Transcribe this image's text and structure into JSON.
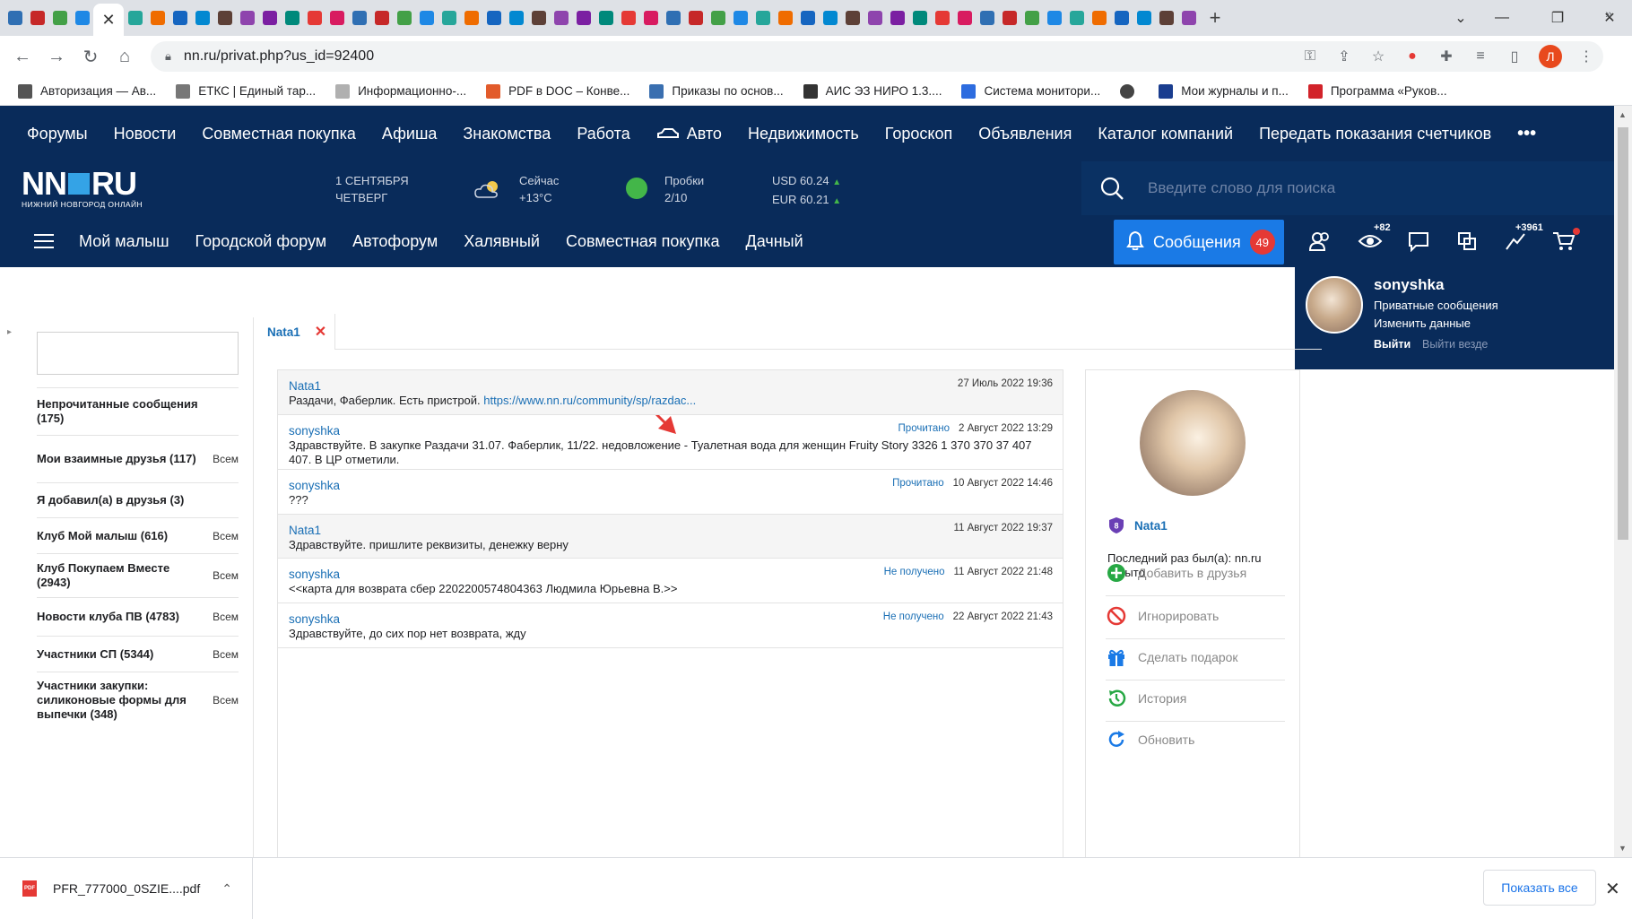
{
  "browser": {
    "tabs_count": 52,
    "active_tab_close": "✕",
    "new_tab": "+",
    "window_controls": {
      "minimize": "—",
      "restore": "❐",
      "close": "✕"
    },
    "url": "nn.ru/privat.php?us_id=92400",
    "profile_initial": "Л",
    "extension_badge": "4"
  },
  "bookmarks": [
    {
      "label": "Авторизация — Ав...",
      "color": "#555555"
    },
    {
      "label": "ЕТКС | Единый тар...",
      "color": "#777777"
    },
    {
      "label": "Информационно-...",
      "color": "#b0b0b0"
    },
    {
      "label": "PDF в DOC – Конве...",
      "color": "#e25b2b"
    },
    {
      "label": "Приказы по основ...",
      "color": "#3a6fb0"
    },
    {
      "label": "АИС ЭЗ НИРО 1.3....",
      "color": "#333333"
    },
    {
      "label": "Система монитори...",
      "color": "#2d6cdf"
    },
    {
      "label": "",
      "color": "#444444"
    },
    {
      "label": "Мои журналы и п...",
      "color": "#1a3d8f"
    },
    {
      "label": "Программа «Руков...",
      "color": "#d2232a"
    }
  ],
  "site": {
    "topnav": [
      "Форумы",
      "Новости",
      "Совместная покупка",
      "Афиша",
      "Знакомства",
      "Работа",
      "Авто",
      "Недвижимость",
      "Гороскоп",
      "Объявления",
      "Каталог компаний",
      "Передать показания счетчиков"
    ],
    "topnav_more": "•••",
    "logo_main_left": "NN",
    "logo_main_right": "RU",
    "logo_sub": "НИЖНИЙ НОВГОРОД ОНЛАЙН",
    "date_line1": "1 СЕНТЯБРЯ",
    "date_line2": "ЧЕТВЕРГ",
    "weather_label": "Сейчас",
    "weather_value": "+13°C",
    "traffic_label": "Пробки",
    "traffic_value": "2/10",
    "usd": "USD 60.24",
    "eur": "EUR 60.21",
    "search_placeholder": "Введите слово для поиска",
    "subnav": [
      "Мой малыш",
      "Городской форум",
      "Автофорум",
      "Халявный",
      "Совместная покупка",
      "Дачный"
    ],
    "messages_button": "Сообщения",
    "messages_count": "49",
    "views_count": "+82",
    "rating_count": "+3961"
  },
  "user_panel": {
    "username": "sonyshka",
    "private_messages": "Приватные сообщения",
    "edit_profile": "Изменить данные",
    "logout": "Выйти",
    "logout_all": "Выйти везде"
  },
  "sidebar": {
    "items": [
      {
        "label": "Непрочитанные сообщения (175)",
        "scope": ""
      },
      {
        "label": "Мои взаимные друзья (117)",
        "scope": "Всем"
      },
      {
        "label": "Я добавил(а) в друзья (3)",
        "scope": ""
      },
      {
        "label": "Клуб Мой малыш (616)",
        "scope": "Всем"
      },
      {
        "label": "Клуб Покупаем Вместе (2943)",
        "scope": "Всем"
      },
      {
        "label": "Новости клуба ПВ (4783)",
        "scope": "Всем"
      },
      {
        "label": "Участники СП (5344)",
        "scope": "Всем"
      },
      {
        "label": "Участники закупки: силиконовые формы для выпечки (348)",
        "scope": "Всем"
      }
    ]
  },
  "conversation": {
    "tab_name": "Nata1",
    "tab_close": "✕",
    "messages": [
      {
        "author": "Nata1",
        "status": "",
        "date": "27 Июль 2022 19:36",
        "text": "Раздачи, Фаберлик. Есть пристрой. ",
        "link": "https://www.nn.ru/community/sp/razdac...",
        "shaded": true
      },
      {
        "author": "sonyshka",
        "status": "Прочитано",
        "date": "2 Август 2022 13:29",
        "text": "Здравствуйте. В закупке Раздачи 31.07. Фаберлик, 11/22. недовложение - Туалетная вода для женщин Fruity Story 3326 1 370 370 37 407 407. В ЦР отметили.",
        "link": "",
        "shaded": false
      },
      {
        "author": "sonyshka",
        "status": "Прочитано",
        "date": "10 Август 2022 14:46",
        "text": "???",
        "link": "",
        "shaded": false
      },
      {
        "author": "Nata1",
        "status": "",
        "date": "11 Август 2022 19:37",
        "text": "Здравствуйте. пришлите реквизиты, денежку верну",
        "link": "",
        "shaded": true
      },
      {
        "author": "sonyshka",
        "status": "Не получено",
        "date": "11 Август 2022 21:48",
        "text": "<<карта для возврата сбер 2202200574804363 Людмила Юрьевна В.>>",
        "link": "",
        "shaded": false
      },
      {
        "author": "sonyshka",
        "status": "Не получено",
        "date": "22 Август 2022 21:43",
        "text": "Здравствуйте, до сих пор нет возврата, жду",
        "link": "",
        "shaded": false
      }
    ]
  },
  "profile_card": {
    "name": "Nata1",
    "badge_letter": "8",
    "last_seen": "Последний раз был(а): nn.ru скрыто",
    "actions": [
      {
        "label": "Добавить в друзья",
        "icon": "add-friend-icon",
        "color": "#27a844"
      },
      {
        "label": "Игнорировать",
        "icon": "ignore-icon",
        "color": "#e53935"
      },
      {
        "label": "Сделать подарок",
        "icon": "gift-icon",
        "color": "#1a7ae6"
      },
      {
        "label": "История",
        "icon": "history-icon",
        "color": "#27a844"
      },
      {
        "label": "Обновить",
        "icon": "refresh-icon",
        "color": "#1a7ae6"
      }
    ]
  },
  "downloads": {
    "file_name": "PFR_777000_0SZIE....pdf",
    "file_icon_text": "PDF",
    "show_all": "Показать все",
    "close": "✕"
  },
  "colors": {
    "brand_navy": "#092b5a",
    "accent_blue": "#1a7ae6",
    "link_blue": "#1a6fb5",
    "badge_red": "#e53935"
  }
}
